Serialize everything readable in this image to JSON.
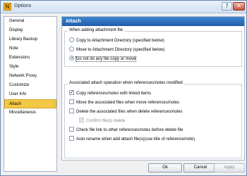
{
  "window": {
    "title": "Options",
    "app_icon": "N",
    "help_label": "?",
    "close_label": "✕"
  },
  "nav": {
    "items": [
      {
        "label": "General",
        "selected": false
      },
      {
        "label": "Display",
        "selected": false
      },
      {
        "label": "Library Backup",
        "selected": false
      },
      {
        "label": "Note",
        "selected": false
      },
      {
        "label": "Extensions",
        "selected": false
      },
      {
        "label": "Style",
        "selected": false
      },
      {
        "label": "Network Proxy",
        "selected": false
      },
      {
        "label": "Customize",
        "selected": false
      },
      {
        "label": "User Info",
        "selected": false
      },
      {
        "label": "Attach",
        "selected": true
      },
      {
        "label": "Miscellaneous",
        "selected": false
      }
    ]
  },
  "panel": {
    "title": "Attach",
    "group1": {
      "legend": "When adding attachment file",
      "options": [
        {
          "label": "Copy to Attachment Directory (specified below)",
          "checked": false
        },
        {
          "label": "Move to Attachment Directory (specified below)",
          "checked": false
        },
        {
          "label": "Do not do any file copy or move",
          "checked": true
        }
      ]
    },
    "group2": {
      "legend": "Associated attach operation when references/notes modified",
      "options": [
        {
          "label": "Copy references/notes with linked items",
          "checked": true,
          "disabled": false
        },
        {
          "label": "Move the associated files when move references/notes",
          "checked": false,
          "disabled": false
        },
        {
          "label": "Delete the associated files when delete references/notes",
          "checked": false,
          "disabled": false
        },
        {
          "label": "Confirm file(s) delete",
          "checked": true,
          "disabled": true
        },
        {
          "label": "Check file link to other references/notes before delete file",
          "checked": false,
          "disabled": false
        },
        {
          "label": "Auto rename when add  attach file(s)(use title of reference/note)",
          "checked": false,
          "disabled": false
        }
      ]
    }
  },
  "buttons": {
    "ok": "Ok",
    "cancel": "Cancel",
    "apply": "Apply"
  }
}
